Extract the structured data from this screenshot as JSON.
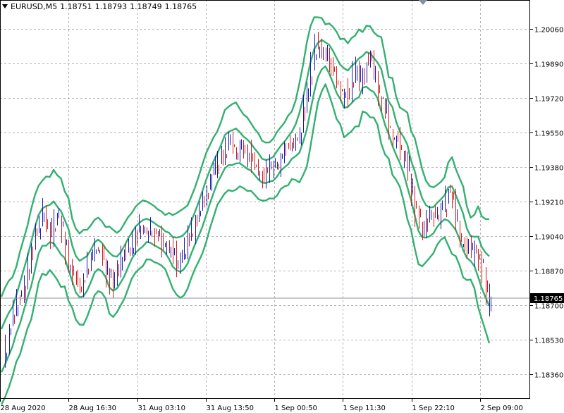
{
  "header": {
    "symbol": "EURUSD,M5",
    "open": "1.18751",
    "high": "1.18793",
    "low": "1.18749",
    "close": "1.18765"
  },
  "colors": {
    "background": "#ffffff",
    "grid": "#b4b4b4",
    "band": "#33b070",
    "bull": "#1a1ab4",
    "bear": "#d21e1e",
    "price_line": "#8c96a0",
    "price_label_bg": "#000000"
  },
  "chart_data": {
    "type": "line",
    "title": "EURUSD,M5",
    "xlabel": "",
    "ylabel": "",
    "grid": true,
    "ylim": [
      1.18265,
      1.20155
    ],
    "y_ticks": [
      "1.20060",
      "1.19890",
      "1.19720",
      "1.19550",
      "1.19380",
      "1.19210",
      "1.19040",
      "1.18870",
      "1.18700",
      "1.18530",
      "1.18360"
    ],
    "x_ticks": [
      "28 Aug 2020",
      "28 Aug 16:30",
      "31 Aug 03:10",
      "31 Aug 13:50",
      "1 Sep 00:50",
      "1 Sep 11:30",
      "1 Sep 22:10",
      "2 Sep 09:00"
    ],
    "current_price": "1.18765",
    "x_index": [
      0,
      2,
      4,
      6,
      8,
      10,
      12,
      14,
      16,
      18,
      20,
      22,
      24,
      26,
      28,
      30,
      32,
      34,
      36,
      38,
      40,
      42,
      44,
      46,
      48,
      50,
      52,
      54,
      56,
      58,
      60,
      62,
      64,
      66,
      68,
      70,
      72,
      74,
      76,
      78,
      80,
      82,
      84,
      86,
      88,
      90,
      92,
      94,
      96,
      98,
      100,
      102,
      104,
      106,
      108,
      110,
      112,
      114,
      116,
      118,
      120,
      122,
      124,
      126,
      128,
      130,
      132,
      134,
      136,
      138,
      140,
      142,
      144,
      146,
      148,
      150,
      152,
      154,
      156,
      158,
      160,
      162,
      164,
      166,
      168,
      170,
      172,
      174,
      176,
      178,
      180,
      182,
      184,
      186,
      188,
      190,
      192,
      194,
      196,
      198,
      200,
      202,
      204,
      206,
      208,
      210,
      212,
      214,
      216,
      218,
      220,
      222,
      224,
      226,
      228,
      230,
      232,
      234,
      236,
      238,
      240,
      242,
      244,
      246,
      248,
      250,
      252,
      254,
      256,
      258,
      260,
      262,
      264,
      266,
      268,
      270,
      272,
      274,
      276,
      278,
      280,
      282,
      284,
      286,
      288,
      290,
      292,
      294,
      296,
      298,
      300,
      302,
      304,
      306,
      308,
      310,
      312,
      314,
      316,
      318,
      320,
      322,
      324,
      326,
      328,
      330,
      332,
      334,
      336,
      338,
      340,
      342,
      344
    ],
    "series": [
      {
        "values": [
          1.1843,
          1.1852,
          1.186,
          1.1868,
          1.1874,
          1.1873,
          1.188,
          1.1892,
          1.19,
          1.1906,
          1.1911,
          1.1916,
          1.1909,
          1.1903,
          1.1912,
          1.1914,
          1.1903,
          1.1896,
          1.1888,
          1.1886,
          1.188,
          1.1876,
          1.1884,
          1.1892,
          1.1896,
          1.1898,
          1.1897,
          1.1892,
          1.1885,
          1.1882,
          1.188,
          1.1889,
          1.1894,
          1.1897,
          1.1898,
          1.19,
          1.1907,
          1.1909,
          1.1906,
          1.1905,
          1.1907,
          1.1904,
          1.1903,
          1.19,
          1.19,
          1.1898,
          1.1895,
          1.1888,
          1.1895,
          1.1899,
          1.1904,
          1.1907,
          1.1912,
          1.1918,
          1.1922,
          1.1929,
          1.1934,
          1.1939,
          1.1942,
          1.1944,
          1.1948,
          1.1955,
          1.1947,
          1.1944,
          1.1948,
          1.1944,
          1.1946,
          1.194,
          1.1937,
          1.1936,
          1.1933,
          1.1935,
          1.1938,
          1.194,
          1.194,
          1.1945,
          1.1949,
          1.1947,
          1.195,
          1.1953,
          1.1957,
          1.1967,
          1.1979,
          1.1988,
          1.1998,
          1.1996,
          1.1993,
          1.1992,
          1.1989,
          1.1986,
          1.1978,
          1.1971,
          1.1976,
          1.1974,
          1.1984,
          1.1988,
          1.198,
          1.1984,
          1.1989,
          1.199,
          1.1982,
          1.1972,
          1.1971,
          1.1964,
          1.1954,
          1.195,
          1.1951,
          1.1942,
          1.1942,
          1.1934,
          1.1924,
          1.1915,
          1.191,
          1.1904,
          1.1912,
          1.1915,
          1.1914,
          1.1914,
          1.1917,
          1.1922,
          1.1924,
          1.1922,
          1.191,
          1.19,
          1.19,
          1.1898,
          1.1894,
          1.1897,
          1.1893,
          1.1887,
          1.1871,
          1.1876
        ],
        "x_range": [
          0,
          262
        ]
      }
    ]
  }
}
